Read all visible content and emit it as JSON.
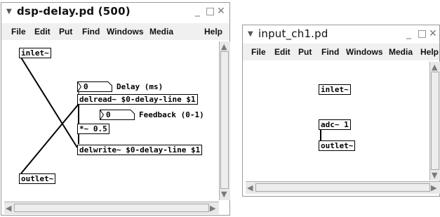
{
  "windows": {
    "dsp_delay": {
      "title": "dsp-delay.pd  (500)",
      "menu": [
        "File",
        "Edit",
        "Put",
        "Find",
        "Windows",
        "Media",
        "Help"
      ],
      "objects": {
        "inlet": "inlet~",
        "outlet": "outlet~",
        "delread": "delread~ $0-delay-line $1",
        "mult": "*~ 0.5",
        "delwrite": "delwrite~ $0-delay-line $1"
      },
      "numboxes": {
        "delay_value": "0",
        "feedback_value": "0"
      },
      "comments": {
        "delay": "Delay (ms)",
        "feedback": "Feedback (0-1)"
      }
    },
    "input_ch1": {
      "title": "input_ch1.pd",
      "menu": [
        "File",
        "Edit",
        "Put",
        "Find",
        "Windows",
        "Media",
        "Help"
      ],
      "objects": {
        "inlet": "inlet~",
        "adc": "adc~ 1",
        "outlet": "outlet~"
      }
    }
  },
  "icons": {
    "collapse": "▼",
    "minimize": "_",
    "maximize": "□",
    "close": "✕"
  }
}
